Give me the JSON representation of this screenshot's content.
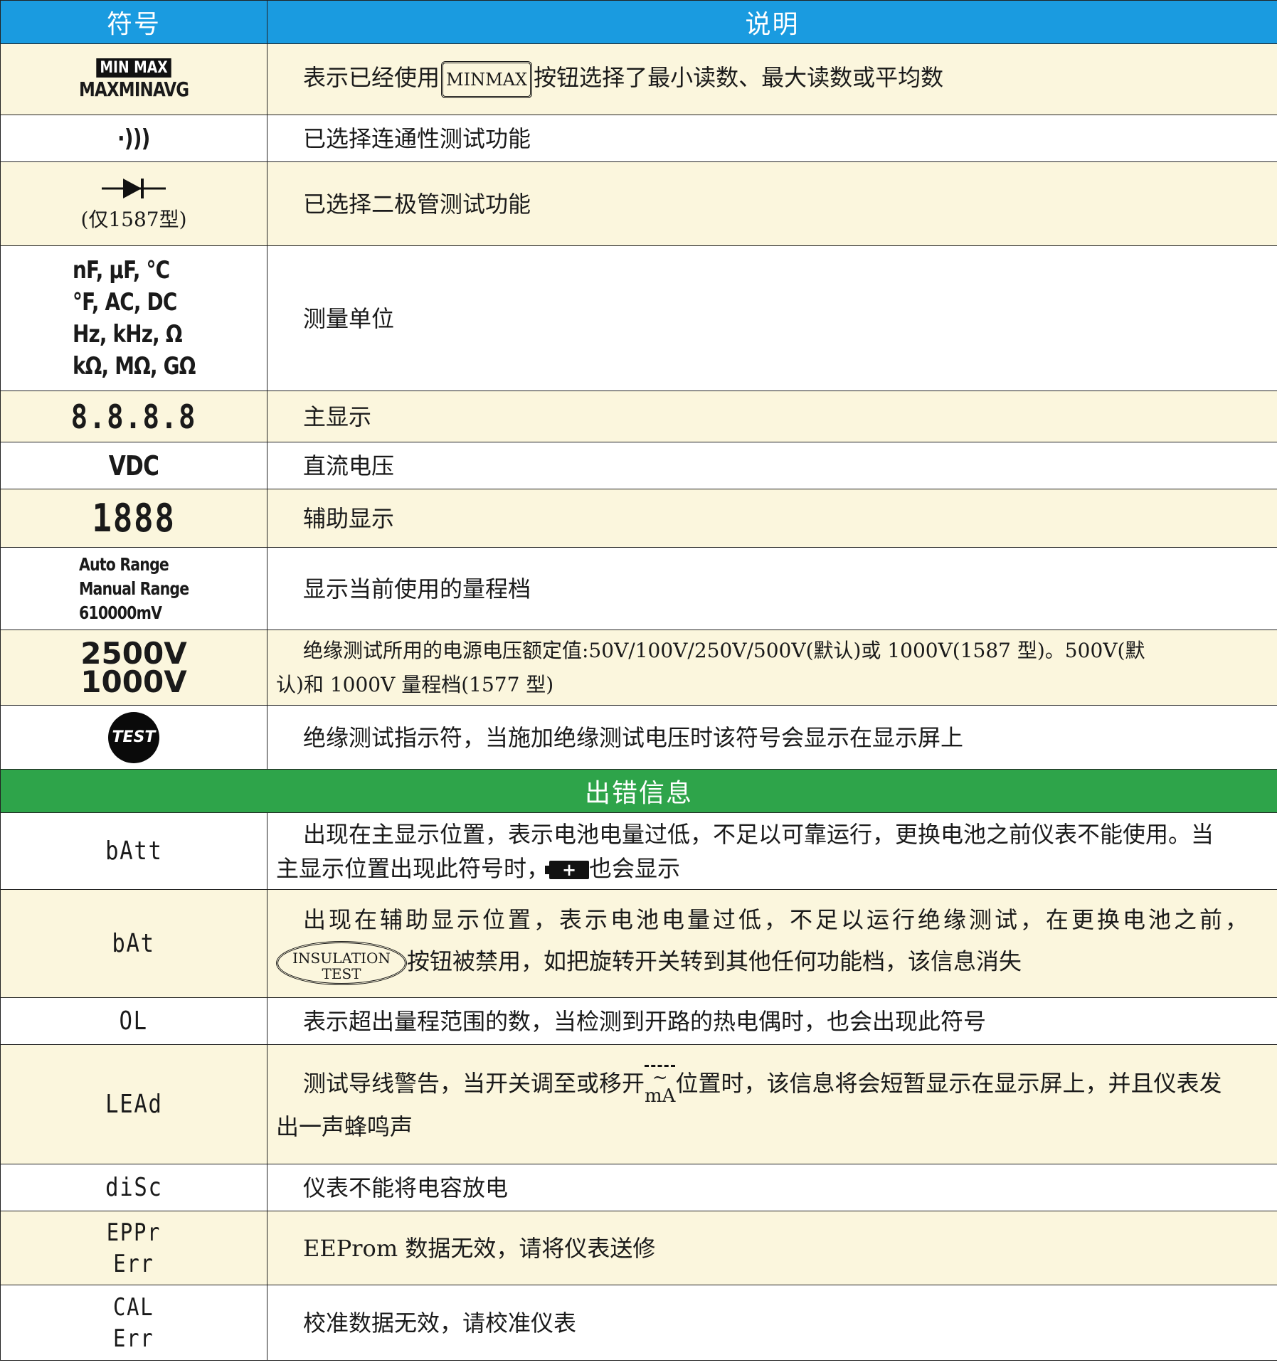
{
  "header": {
    "symbol": "符号",
    "description": "说明"
  },
  "rows": [
    {
      "sym_badge": "MIN MAX",
      "sym_line2": "MAXMINAVG",
      "desc_pre": "表示已经使用",
      "desc_button": "MINMAX",
      "desc_post": "按钮选择了最小读数、最大读数或平均数"
    },
    {
      "sym": "·)))",
      "desc": "已选择连通性测试功能"
    },
    {
      "sym_note": "(仅1587型)",
      "desc": "已选择二极管测试功能"
    },
    {
      "sym_lines": [
        "nF, μF, °C",
        "°F, AC, DC",
        "Hz, kHz, Ω",
        "kΩ, MΩ, GΩ"
      ],
      "desc": "测量单位"
    },
    {
      "sym": "8.8.8.8",
      "desc": "主显示"
    },
    {
      "sym": "VDC",
      "desc": "直流电压"
    },
    {
      "sym": "1888",
      "desc": "辅助显示"
    },
    {
      "sym_lines": [
        "Auto Range",
        "Manual Range",
        "610000mV"
      ],
      "desc": "显示当前使用的量程档"
    },
    {
      "sym_lines": [
        "2500V",
        "1000V"
      ],
      "desc_line1": "绝缘测试所用的电源电压额定值:50V/100V/250V/500V(默认)或 1000V(1587 型)。500V(默",
      "desc_line2": "认)和 1000V 量程档(1577 型)"
    },
    {
      "sym": "TEST",
      "desc": "绝缘测试指示符，当施加绝缘测试电压时该符号会显示在显示屏上"
    }
  ],
  "section2": {
    "title": "出错信息"
  },
  "errors": [
    {
      "sym": "bAtt",
      "desc_line1": "出现在主显示位置，表示电池电量过低，不足以可靠运行，更换电池之前仪表不能使用。当",
      "desc_line2_pre": "主显示位置出现此符号时，",
      "desc_line2_post": "也会显示",
      "batt_icon": "+"
    },
    {
      "sym": "bAt",
      "desc_line1": "出现在辅助显示位置，表示电池电量过低，不足以运行绝缘测试，在更换电池之前，",
      "button_line1": "INSULATION",
      "button_line2": "TEST",
      "desc_line2": "按钮被禁用，如把旋转开关转到其他任何功能档，该信息消失"
    },
    {
      "sym": "OL",
      "desc": "表示超出量程范围的数，当检测到开路的热电偶时，也会出现此符号"
    },
    {
      "sym": "LEAd",
      "desc_pre": "测试导线警告，当开关调至或移开",
      "frac_top": "~",
      "frac_bottom": "mA",
      "desc_post": "位置时，该信息将会短暂显示在显示屏上，并且仪表发",
      "desc_line2": "出一声蜂鸣声"
    },
    {
      "sym": "diSc",
      "desc": "仪表不能将电容放电"
    },
    {
      "sym_lines": [
        "EPPr",
        "Err"
      ],
      "desc": "EEProm 数据无效，请将仪表送修"
    },
    {
      "sym_lines": [
        "CAL",
        "Err"
      ],
      "desc": "校准数据无效，请校准仪表"
    }
  ],
  "colors": {
    "header_blue": "#1a9be0",
    "section_green": "#2ea44a",
    "row_yellow": "#fbf6dd"
  }
}
